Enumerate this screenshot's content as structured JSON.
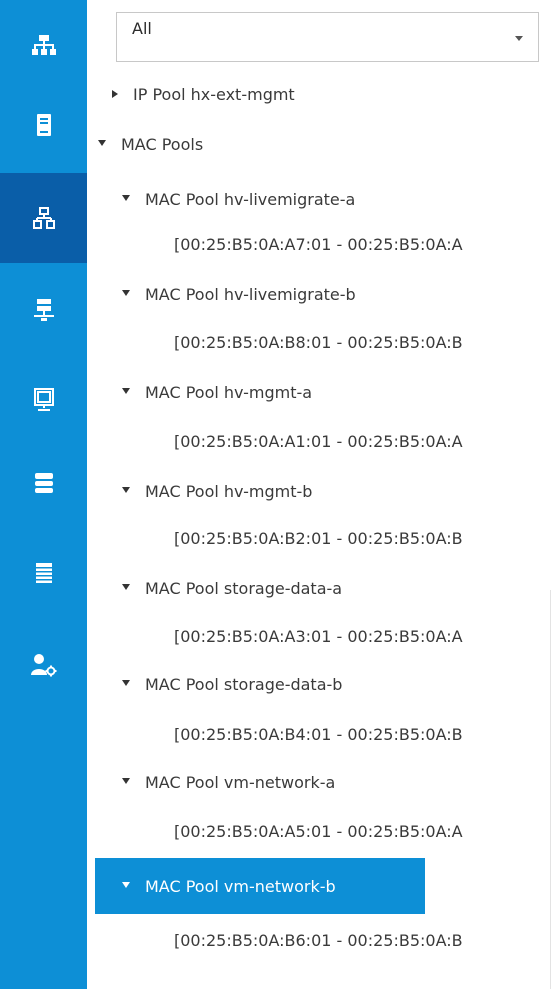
{
  "filter": {
    "value": "All"
  },
  "nav": [
    {
      "icon": "network-topology-icon",
      "active": false
    },
    {
      "icon": "server-icon",
      "active": false
    },
    {
      "icon": "lan-icon",
      "active": true
    },
    {
      "icon": "san-storage-icon",
      "active": false
    },
    {
      "icon": "vm-monitor-icon",
      "active": false
    },
    {
      "icon": "storage-stack-icon",
      "active": false
    },
    {
      "icon": "chassis-list-icon",
      "active": false
    },
    {
      "icon": "admin-user-gear-icon",
      "active": false
    }
  ],
  "tree": {
    "ip_pool_ext": "IP Pool hx-ext-mgmt",
    "mac_pools": "MAC Pools",
    "pools": [
      {
        "name": "MAC Pool hv-livemigrate-a",
        "range": "[00:25:B5:0A:A7:01 - 00:25:B5:0A:A"
      },
      {
        "name": "MAC Pool hv-livemigrate-b",
        "range": "[00:25:B5:0A:B8:01 - 00:25:B5:0A:B"
      },
      {
        "name": "MAC Pool hv-mgmt-a",
        "range": "[00:25:B5:0A:A1:01 - 00:25:B5:0A:A"
      },
      {
        "name": "MAC Pool hv-mgmt-b",
        "range": "[00:25:B5:0A:B2:01 - 00:25:B5:0A:B"
      },
      {
        "name": "MAC Pool storage-data-a",
        "range": "[00:25:B5:0A:A3:01 - 00:25:B5:0A:A"
      },
      {
        "name": "MAC Pool storage-data-b",
        "range": "[00:25:B5:0A:B4:01 - 00:25:B5:0A:B"
      },
      {
        "name": "MAC Pool vm-network-a",
        "range": "[00:25:B5:0A:A5:01 - 00:25:B5:0A:A"
      },
      {
        "name": "MAC Pool vm-network-b",
        "range": "[00:25:B5:0A:B6:01 - 00:25:B5:0A:B"
      }
    ]
  },
  "colors": {
    "nav_bg": "#0d8fd6",
    "nav_active": "#0a5ea8",
    "selection": "#0d8fd6"
  }
}
